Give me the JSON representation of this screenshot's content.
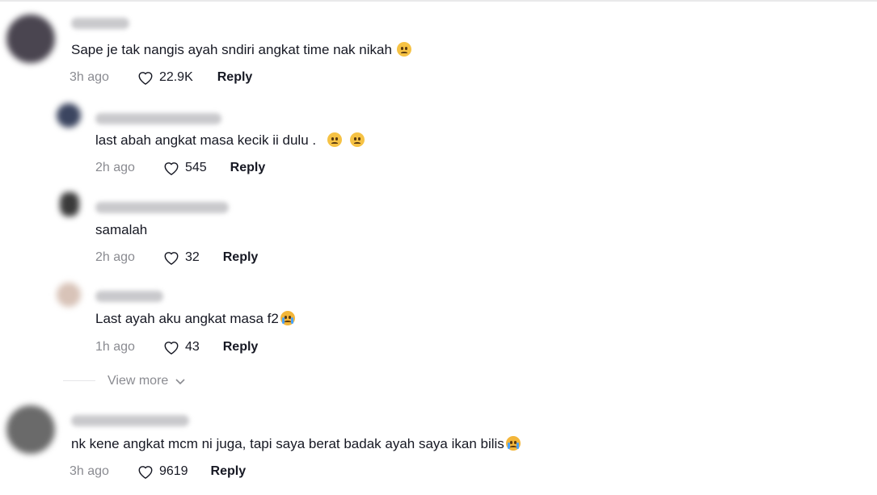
{
  "comments": [
    {
      "text": "Sape je tak nangis ayah sndiri angkat time nak nikah",
      "emoji": "pleading-face",
      "time": "3h ago",
      "likes": "22.9K",
      "reply_label": "Reply",
      "avatar_color": "#4a4550"
    },
    {
      "text": "last abah angkat masa kecik ii dulu .",
      "emoji": [
        "pleading-face",
        "pensive-face"
      ],
      "time": "2h ago",
      "likes": "545",
      "reply_label": "Reply",
      "avatar_color": "#3b4560"
    },
    {
      "text": "samalah",
      "time": "2h ago",
      "likes": "32",
      "reply_label": "Reply",
      "avatar_color": "#3a3a3a"
    },
    {
      "text": "Last ayah aku angkat masa f2",
      "emoji": "loudly-crying-face",
      "time": "1h ago",
      "likes": "43",
      "reply_label": "Reply",
      "avatar_color": "#d8c3b8"
    },
    {
      "text": "nk kene angkat mcm ni juga, tapi saya berat badak ayah saya ikan bilis",
      "emoji": "loudly-crying-face",
      "time": "3h ago",
      "likes": "9619",
      "reply_label": "Reply",
      "avatar_color": "#6a6a6a"
    }
  ],
  "view_more": {
    "label": "View more",
    "icon": "chevron-down-icon"
  }
}
